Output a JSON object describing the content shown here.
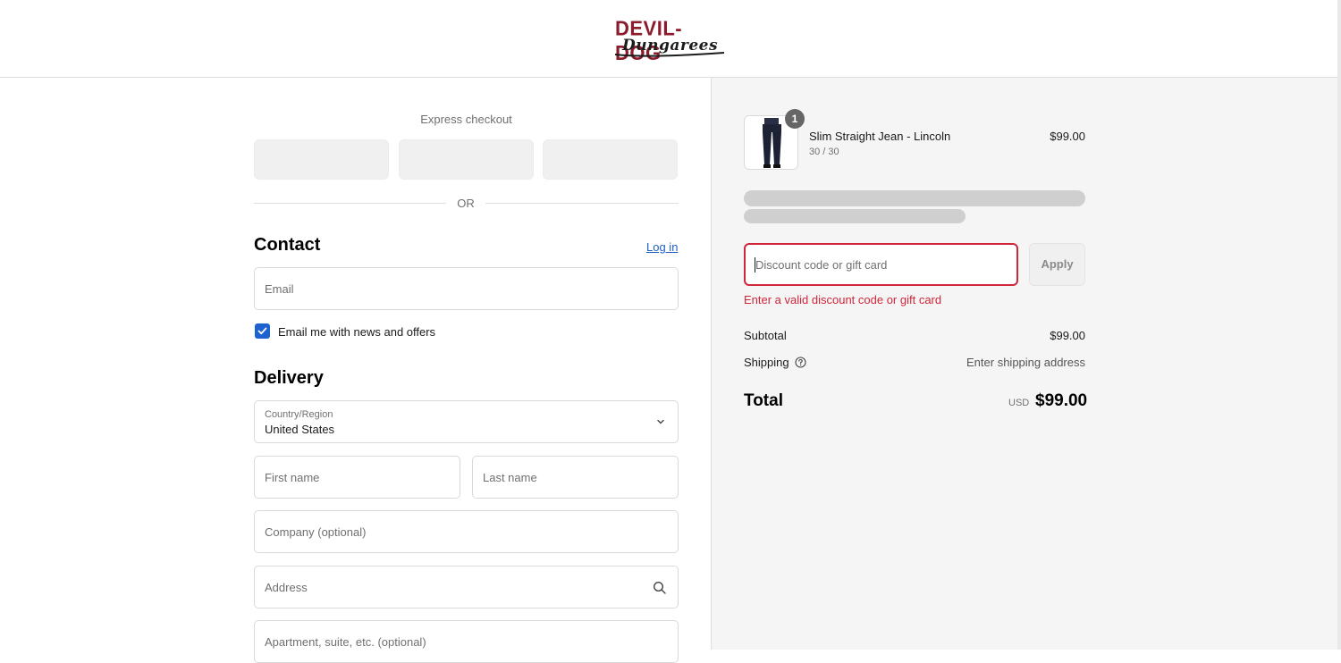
{
  "brand": {
    "logo_top": "DEVIL-DOG",
    "logo_bottom": "Dungarees",
    "primary_color": "#8a1c2b"
  },
  "express": {
    "label": "Express checkout",
    "or_text": "OR"
  },
  "contact": {
    "title": "Contact",
    "login_label": "Log in",
    "email_placeholder": "Email",
    "newsletter_label": "Email me with news and offers",
    "newsletter_checked": true
  },
  "delivery": {
    "title": "Delivery",
    "country_label": "Country/Region",
    "country_value": "United States",
    "first_name_placeholder": "First name",
    "last_name_placeholder": "Last name",
    "company_placeholder": "Company (optional)",
    "address_placeholder": "Address",
    "apartment_placeholder": "Apartment, suite, etc. (optional)"
  },
  "order": {
    "item": {
      "name": "Slim Straight Jean - Lincoln",
      "variant": "30 / 30",
      "price": "$99.00",
      "quantity": "1"
    },
    "discount_placeholder": "Discount code or gift card",
    "apply_label": "Apply",
    "error_message": "Enter a valid discount code or gift card",
    "subtotal_label": "Subtotal",
    "subtotal_value": "$99.00",
    "shipping_label": "Shipping",
    "shipping_value": "Enter shipping address",
    "total_label": "Total",
    "currency": "USD",
    "total_value": "$99.00"
  },
  "colors": {
    "link": "#1f5fc4",
    "error": "#d0263b",
    "checkbox": "#1e62d0"
  }
}
